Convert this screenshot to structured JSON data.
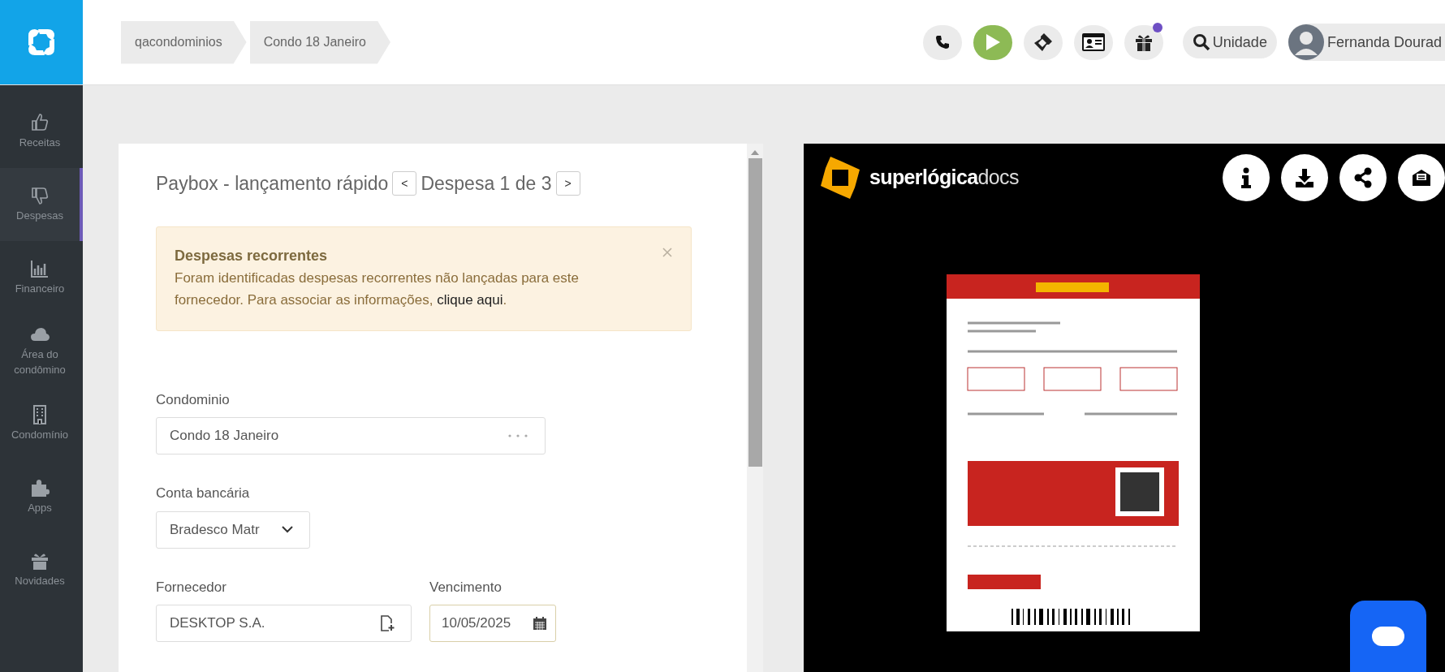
{
  "breadcrumbs": [
    "qacondominios",
    "Condo 18 Janeiro"
  ],
  "topbar": {
    "search_label": "Unidade",
    "user_name": "Fernanda Dourad",
    "gift_notification": true
  },
  "sidebar": {
    "items": [
      {
        "label": "Receitas",
        "selected": false
      },
      {
        "label": "Despesas",
        "selected": true
      },
      {
        "label": "Financeiro",
        "selected": false
      },
      {
        "label": "Área do condômino",
        "selected": false
      },
      {
        "label": "Condomínio",
        "selected": false
      },
      {
        "label": "Apps",
        "selected": false
      },
      {
        "label": "Novidades",
        "selected": false
      }
    ]
  },
  "form": {
    "title": "Paybox - lançamento rápido",
    "prev": "<",
    "counter": "Despesa 1 de 3",
    "next": ">",
    "alert": {
      "title": "Despesas recorrentes",
      "text": "Foram identificadas despesas recorrentes não lançadas para este fornecedor. Para associar as informações,",
      "link": "clique aqui",
      "after": "."
    },
    "fields": [
      {
        "kind": "picker",
        "label": "Condominio",
        "value": "Condo 18 Janeiro"
      },
      {
        "kind": "select",
        "label": "Conta bancária",
        "value": "Bradesco Matr"
      },
      {
        "kind": "supplier",
        "label": "Fornecedor",
        "value": "DESKTOP S.A."
      },
      {
        "kind": "date",
        "label": "Vencimento",
        "value": "10/05/2025"
      }
    ]
  },
  "viewer": {
    "brand_bold": "superlógica",
    "brand_light": "docs"
  }
}
